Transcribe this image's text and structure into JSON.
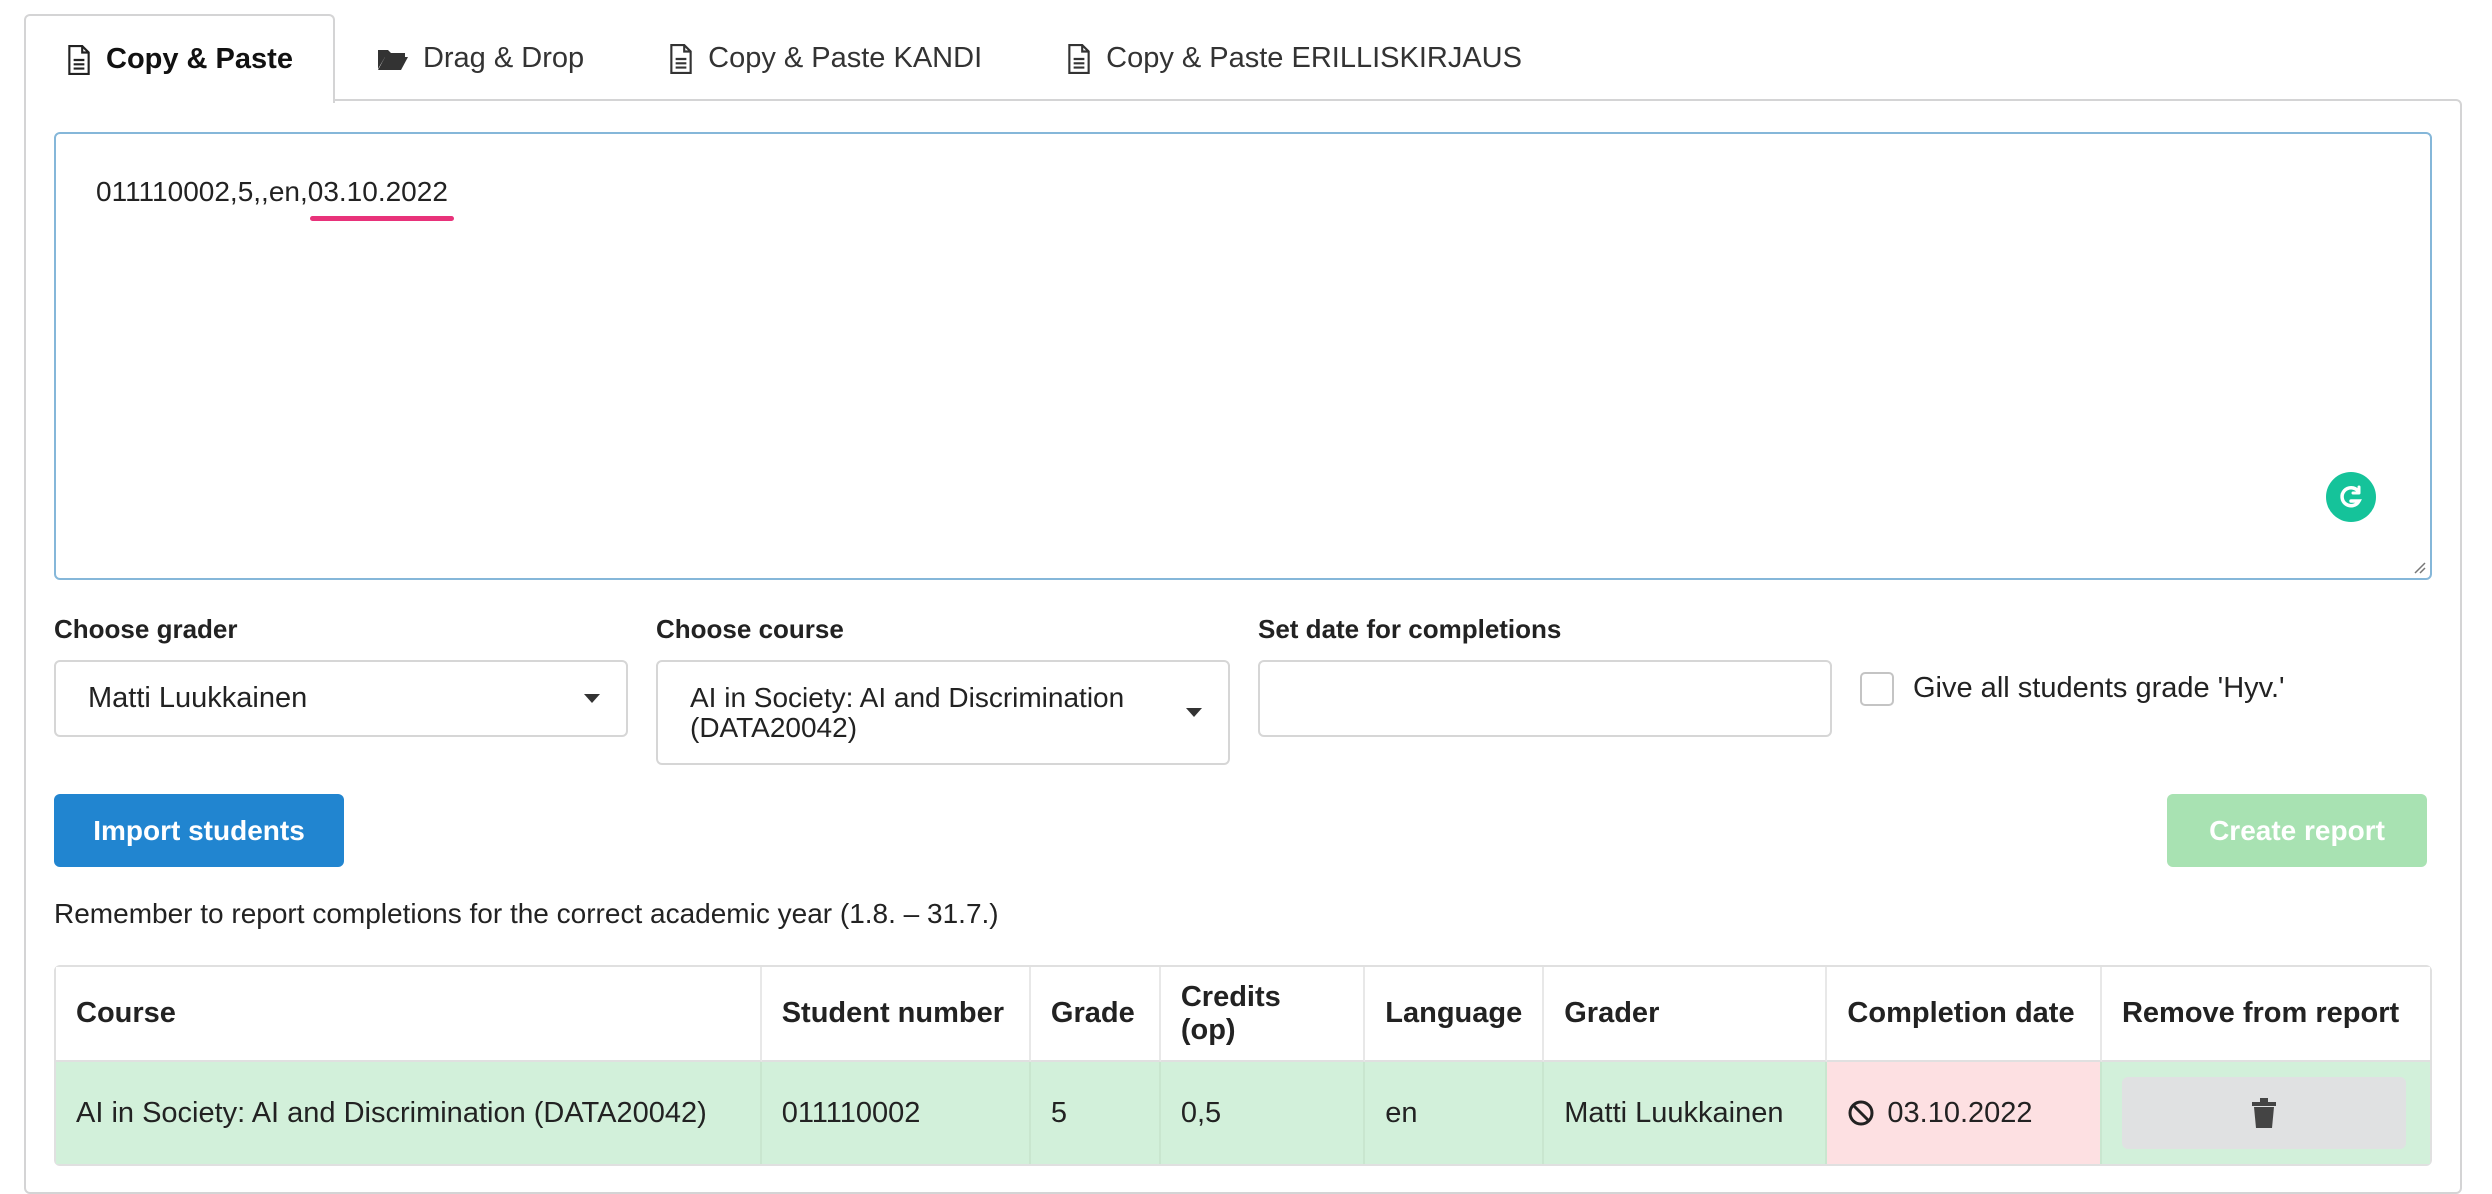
{
  "tabs": [
    {
      "label": "Copy & Paste",
      "icon": "document-icon",
      "active": true
    },
    {
      "label": "Drag & Drop",
      "icon": "folder-open-icon",
      "active": false
    },
    {
      "label": "Copy & Paste KANDI",
      "icon": "document-icon",
      "active": false
    },
    {
      "label": "Copy & Paste ERILLISKIRJAUS",
      "icon": "document-icon",
      "active": false
    }
  ],
  "textarea": {
    "value": "011110002,5,,en,03.10.2022"
  },
  "grader": {
    "label": "Choose grader",
    "selected": "Matti Luukkainen"
  },
  "course": {
    "label": "Choose course",
    "selected": "AI in Society: AI and Discrimination (DATA20042)"
  },
  "date": {
    "label": "Set date for completions",
    "value": ""
  },
  "hyv": {
    "label": "Give all students grade 'Hyv.'",
    "checked": false
  },
  "buttons": {
    "import": "Import students",
    "report": "Create report"
  },
  "reminder": "Remember to report completions for the correct academic year (1.8. – 31.7.)",
  "table": {
    "headers": [
      "Course",
      "Student number",
      "Grade",
      "Credits (op)",
      "Language",
      "Grader",
      "Completion date",
      "Remove from report"
    ],
    "rows": [
      {
        "course": "AI in Society: AI and Discrimination (DATA20042)",
        "student_number": "011110002",
        "grade": "5",
        "credits": "0,5",
        "language": "en",
        "grader": "Matti Luukkainen",
        "completion_date": "03.10.2022"
      }
    ]
  },
  "colors": {
    "primary": "#2185d0",
    "positive_disabled": "#a8e2b2",
    "row_ok": "#d2f0da",
    "cell_error": "#fde0e2",
    "grammarly": "#15c39a",
    "spellcheck": "#e8327a"
  }
}
